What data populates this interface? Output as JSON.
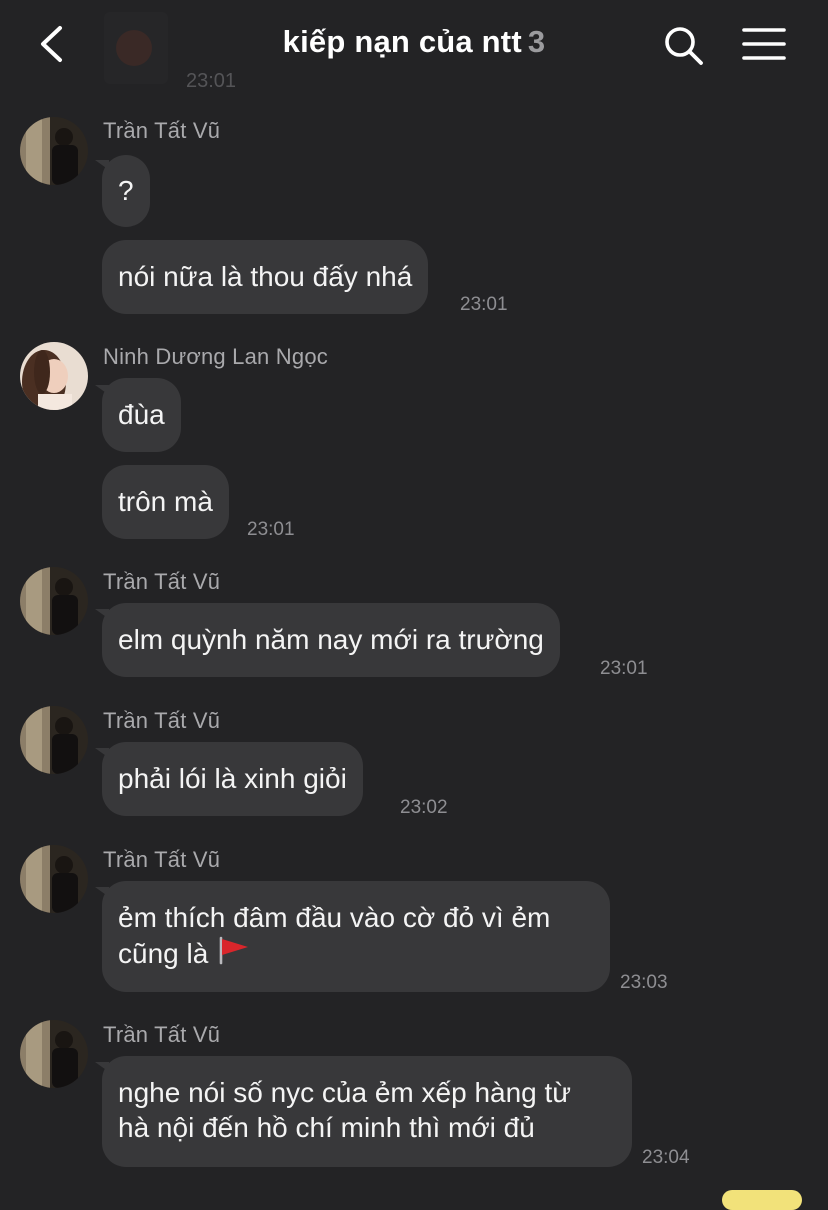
{
  "header": {
    "title": "kiếp nạn của ntt",
    "member_count": "3",
    "back_icon": "chevron-left-icon",
    "search_icon": "search-icon",
    "menu_icon": "hamburger-menu-icon",
    "partial_time": "23:01"
  },
  "messages": [
    {
      "sender": "Trần Tất Vũ",
      "bubbles": [
        "?",
        "nói nữa là thou đấy nhá"
      ],
      "time": "23:01"
    },
    {
      "sender": "Ninh Dương Lan Ngọc",
      "bubbles": [
        "đùa",
        "trôn mà"
      ],
      "time": "23:01"
    },
    {
      "sender": "Trần Tất Vũ",
      "bubbles": [
        "elm quỳnh năm nay mới ra trường"
      ],
      "time": "23:01"
    },
    {
      "sender": "Trần Tất Vũ",
      "bubbles": [
        "phải lói là xinh giỏi"
      ],
      "time": "23:02"
    },
    {
      "sender": "Trần Tất Vũ",
      "lines": [
        "ẻm thích đâm đầu vào cờ đỏ vì ẻm",
        "cũng là"
      ],
      "emoji": "red-flag-emoji",
      "time": "23:03"
    },
    {
      "sender": "Trần Tất Vũ",
      "lines": [
        "nghe nói số nyc của ẻm xếp hàng từ",
        "hà nội đến hồ chí minh thì mới đủ"
      ],
      "time": "23:04"
    }
  ],
  "colors": {
    "background": "#232325",
    "bubble": "#38383a",
    "sender_name": "#a9a9ac",
    "timestamp": "#8e8e92",
    "flag": "#d9262b"
  }
}
